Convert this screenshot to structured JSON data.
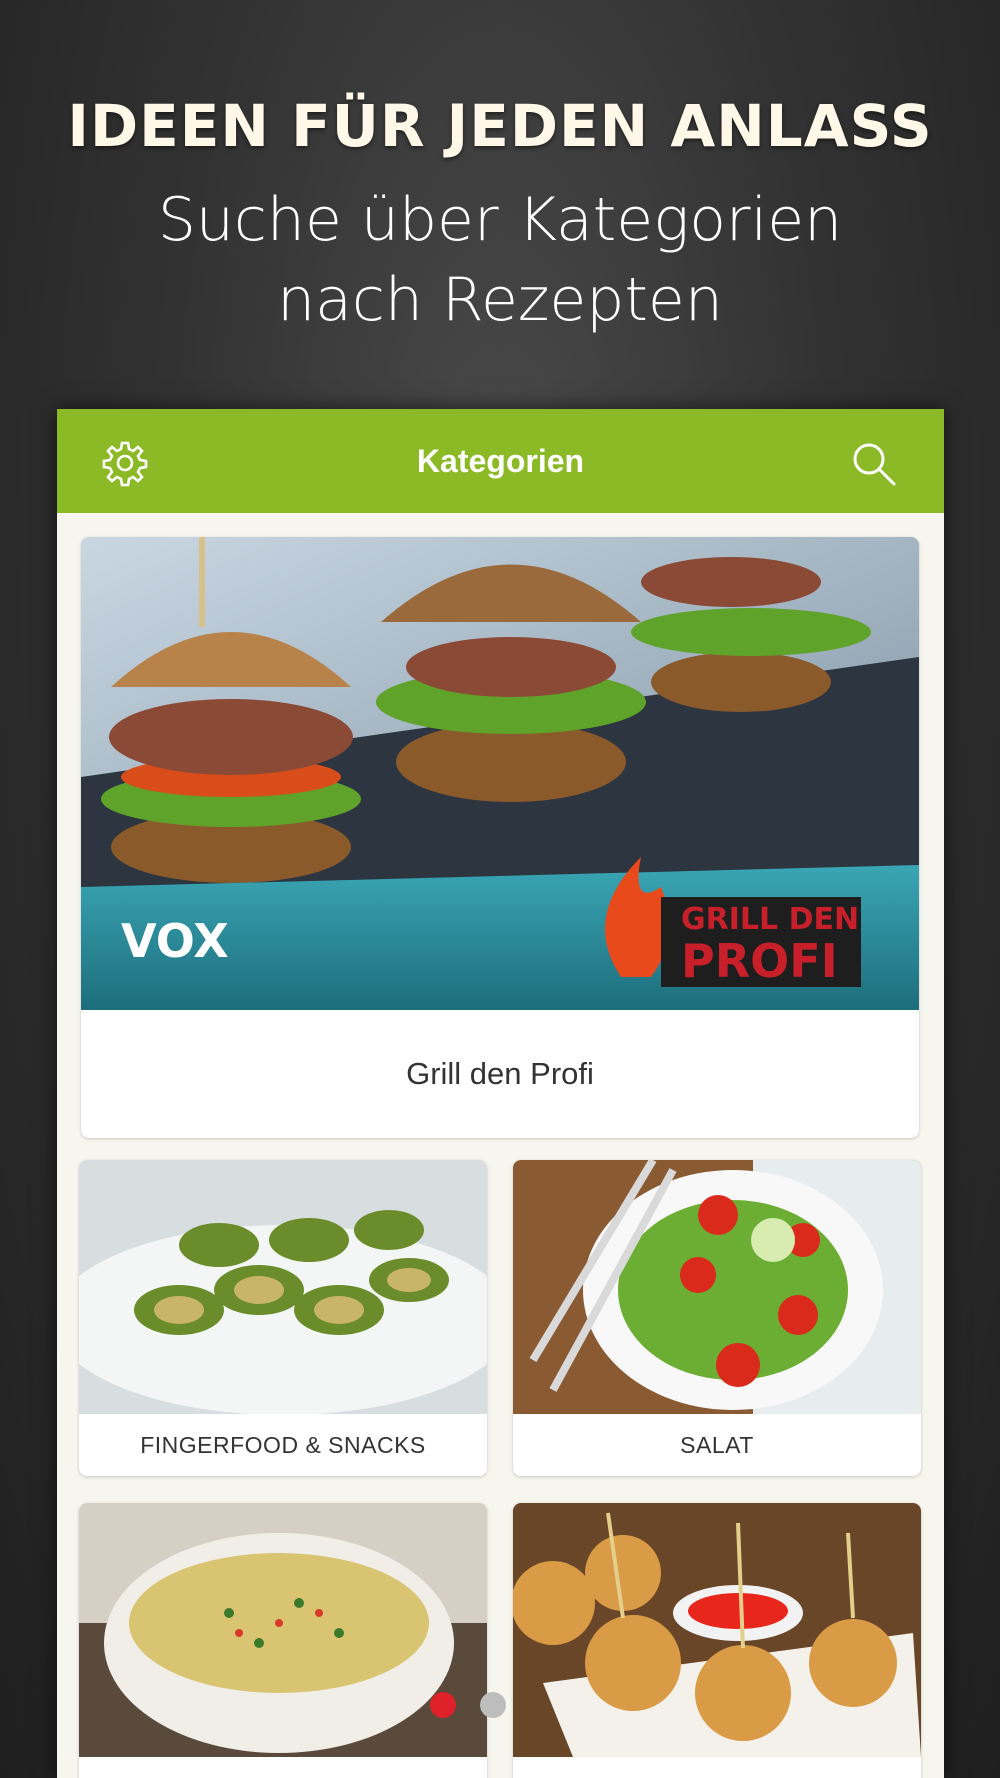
{
  "promo": {
    "headline": "IDEEN FÜR JEDEN ANLASS",
    "subline_1": "Suche über Kategorien",
    "subline_2": "nach Rezepten"
  },
  "appbar": {
    "title": "Kategorien",
    "settings_icon": "gear-icon",
    "search_icon": "search-icon",
    "color": "#8cba27"
  },
  "featured": {
    "label": "Grill den Profi",
    "banner_channel": "VOX",
    "banner_logo_line_1": "GRILL DEN",
    "banner_logo_line_2": "PROFI"
  },
  "categories": [
    {
      "label": "FINGERFOOD & SNACKS"
    },
    {
      "label": "SALAT"
    },
    {
      "label": ""
    },
    {
      "label": ""
    }
  ],
  "pager": {
    "pages": 2,
    "active_page": 1,
    "active_color": "#e0202a",
    "inactive_color": "#bdbdbd"
  }
}
